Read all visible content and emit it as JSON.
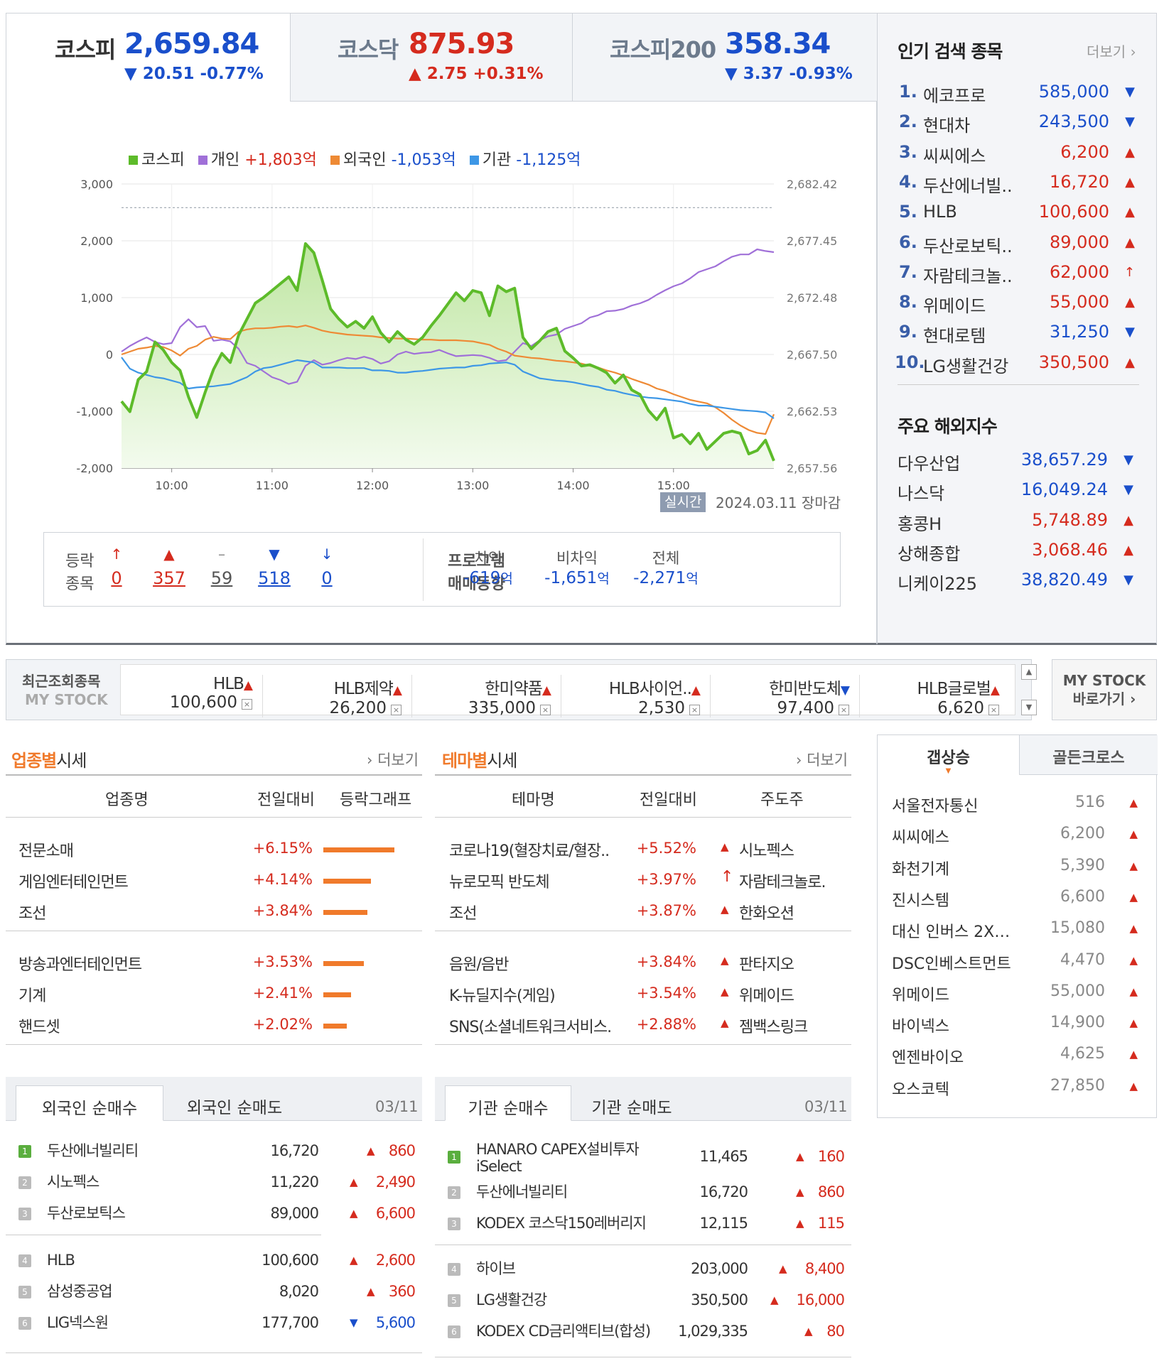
{
  "indices": [
    {
      "name": "코스피",
      "value": "2,659.84",
      "change": "▼ 20.51 -0.77%",
      "dir": "down"
    },
    {
      "name": "코스닥",
      "value": "875.93",
      "change": "▲ 2.75 +0.31%",
      "dir": "up"
    },
    {
      "name": "코스피200",
      "value": "358.34",
      "change": "▼ 3.37 -0.93%",
      "dir": "down"
    }
  ],
  "legend": [
    {
      "label": "코스피",
      "value": "",
      "color": "#5dbb2a"
    },
    {
      "label": "개인",
      "value": "+1,803억",
      "color": "#a070d8"
    },
    {
      "label": "외국인",
      "value": "-1,053억",
      "color": "#ee8a35"
    },
    {
      "label": "기관",
      "value": "-1,125억",
      "color": "#3d97e6"
    }
  ],
  "chart_data": {
    "type": "line",
    "x_ticks": [
      "10:00",
      "11:00",
      "12:00",
      "13:00",
      "14:00",
      "15:00"
    ],
    "y_left_ticks": [
      "3,000",
      "2,000",
      "1,000",
      "0",
      "-1,000",
      "-2,000"
    ],
    "y_right_ticks": [
      "2,682.42",
      "2,677.45",
      "2,672.48",
      "2,667.50",
      "2,662.53",
      "2,657.56"
    ],
    "ylim_left": [
      -2000,
      3000
    ],
    "ylim_right": [
      2657.56,
      2682.42
    ],
    "prev_close": 2680.35,
    "x_minutes": [
      0,
      5,
      10,
      15,
      20,
      25,
      30,
      35,
      40,
      45,
      50,
      55,
      60,
      65,
      70,
      75,
      80,
      85,
      90,
      95,
      100,
      105,
      110,
      115,
      120,
      125,
      130,
      135,
      140,
      145,
      150,
      155,
      160,
      165,
      170,
      175,
      180,
      185,
      190,
      195,
      200,
      205,
      210,
      215,
      220,
      225,
      230,
      235,
      240,
      245,
      250,
      255,
      260,
      265,
      270,
      275,
      280,
      285,
      290,
      295,
      300,
      305,
      310,
      315,
      320,
      325,
      330,
      335,
      340,
      345,
      350,
      355,
      360,
      365,
      370,
      375,
      380,
      385,
      390
    ],
    "series": [
      {
        "name": "코스피",
        "axis": "right",
        "values": [
          2663.4,
          2662.5,
          2665.3,
          2666.0,
          2668.6,
          2667.9,
          2666.8,
          2666.1,
          2663.8,
          2662.0,
          2664.2,
          2666.2,
          2667.6,
          2666.8,
          2669.2,
          2670.6,
          2672.0,
          2672.5,
          2673.1,
          2673.7,
          2674.3,
          2673.1,
          2677.2,
          2676.4,
          2674.0,
          2671.5,
          2670.6,
          2669.9,
          2670.4,
          2669.8,
          2670.8,
          2669.4,
          2668.6,
          2669.5,
          2668.8,
          2668.4,
          2669.0,
          2670.0,
          2670.9,
          2671.9,
          2672.9,
          2672.2,
          2673.1,
          2672.9,
          2670.9,
          2673.5,
          2673.0,
          2673.3,
          2669.0,
          2668.0,
          2668.7,
          2669.5,
          2669.8,
          2667.8,
          2667.2,
          2666.5,
          2666.6,
          2666.3,
          2665.9,
          2665.0,
          2665.7,
          2664.4,
          2664.0,
          2662.6,
          2661.8,
          2662.8,
          2660.2,
          2660.5,
          2659.7,
          2660.6,
          2659.2,
          2659.9,
          2660.6,
          2660.8,
          2660.6,
          2658.8,
          2659.1,
          2660.0,
          2658.2
        ]
      },
      {
        "name": "개인",
        "axis": "left",
        "values": [
          50,
          150,
          230,
          300,
          220,
          180,
          200,
          480,
          620,
          480,
          500,
          240,
          260,
          230,
          100,
          -150,
          -200,
          -300,
          -400,
          -450,
          -520,
          -480,
          -200,
          -100,
          -180,
          -150,
          -100,
          -60,
          -80,
          -40,
          -80,
          -160,
          -120,
          0,
          50,
          10,
          30,
          40,
          80,
          20,
          -30,
          -20,
          -10,
          -20,
          -60,
          -120,
          -100,
          50,
          200,
          150,
          250,
          320,
          350,
          450,
          500,
          550,
          650,
          690,
          760,
          770,
          800,
          860,
          900,
          960,
          1050,
          1130,
          1200,
          1250,
          1340,
          1450,
          1500,
          1550,
          1640,
          1720,
          1760,
          1760,
          1850,
          1820,
          1800
        ]
      },
      {
        "name": "외국인",
        "axis": "left",
        "values": [
          0,
          50,
          100,
          120,
          150,
          130,
          70,
          -20,
          100,
          150,
          260,
          310,
          280,
          270,
          400,
          440,
          460,
          460,
          470,
          490,
          500,
          480,
          510,
          470,
          420,
          390,
          370,
          350,
          340,
          330,
          320,
          300,
          290,
          280,
          280,
          270,
          260,
          260,
          250,
          250,
          250,
          240,
          230,
          200,
          170,
          100,
          50,
          -20,
          -40,
          -60,
          -70,
          -90,
          -110,
          -120,
          -140,
          -160,
          -200,
          -230,
          -280,
          -320,
          -370,
          -430,
          -480,
          -530,
          -600,
          -640,
          -700,
          -750,
          -800,
          -830,
          -860,
          -930,
          -1030,
          -1150,
          -1250,
          -1330,
          -1380,
          -1400,
          -1053
        ]
      },
      {
        "name": "기관",
        "axis": "left",
        "values": [
          -50,
          -250,
          -320,
          -360,
          -400,
          -420,
          -460,
          -500,
          -600,
          -580,
          -570,
          -560,
          -540,
          -520,
          -460,
          -400,
          -300,
          -240,
          -220,
          -180,
          -140,
          -100,
          -120,
          -140,
          -230,
          -230,
          -230,
          -240,
          -240,
          -240,
          -280,
          -280,
          -290,
          -320,
          -320,
          -300,
          -290,
          -270,
          -250,
          -240,
          -230,
          -230,
          -200,
          -190,
          -160,
          -150,
          -140,
          -180,
          -300,
          -360,
          -420,
          -440,
          -460,
          -470,
          -490,
          -520,
          -550,
          -570,
          -620,
          -640,
          -680,
          -710,
          -740,
          -760,
          -770,
          -790,
          -810,
          -830,
          -870,
          -900,
          -900,
          -920,
          -940,
          -960,
          -980,
          -990,
          -1000,
          -1020,
          -1125
        ]
      }
    ]
  },
  "status": {
    "realtime": "실시간",
    "date": "2024.03.11 장마감"
  },
  "breadth": {
    "label1": "등락",
    "label2": "종목",
    "counts": [
      {
        "v": "0",
        "icon": "↑",
        "cls": "up"
      },
      {
        "v": "357",
        "icon": "▲",
        "cls": "up"
      },
      {
        "v": "59",
        "icon": "–",
        "cls": ""
      },
      {
        "v": "518",
        "icon": "▼",
        "cls": "dn"
      },
      {
        "v": "0",
        "icon": "↓",
        "cls": "dn"
      }
    ],
    "prog1": "프로그램",
    "prog2": "매매동향",
    "program": [
      {
        "h": "차익",
        "v": "-619",
        "u": "억"
      },
      {
        "h": "비차익",
        "v": "-1,651",
        "u": "억"
      },
      {
        "h": "전체",
        "v": "-2,271",
        "u": "억"
      }
    ]
  },
  "popular": {
    "title": "인기 검색 종목",
    "more": "더보기",
    "items": [
      {
        "rank": "1.",
        "name": "에코프로",
        "price": "585,000",
        "dir": "dn",
        "icon": "▼"
      },
      {
        "rank": "2.",
        "name": "현대차",
        "price": "243,500",
        "dir": "dn",
        "icon": "▼"
      },
      {
        "rank": "3.",
        "name": "씨씨에스",
        "price": "6,200",
        "dir": "up",
        "icon": "▲"
      },
      {
        "rank": "4.",
        "name": "두산에너빌..",
        "price": "16,720",
        "dir": "up",
        "icon": "▲"
      },
      {
        "rank": "5.",
        "name": "HLB",
        "price": "100,600",
        "dir": "up",
        "icon": "▲"
      },
      {
        "rank": "6.",
        "name": "두산로보틱..",
        "price": "89,000",
        "dir": "up",
        "icon": "▲"
      },
      {
        "rank": "7.",
        "name": "자람테크놀..",
        "price": "62,000",
        "dir": "up",
        "icon": "↑"
      },
      {
        "rank": "8.",
        "name": "위메이드",
        "price": "55,000",
        "dir": "up",
        "icon": "▲"
      },
      {
        "rank": "9.",
        "name": "현대로템",
        "price": "31,250",
        "dir": "dn",
        "icon": "▼"
      },
      {
        "rank": "10.",
        "name": "LG생활건강",
        "price": "350,500",
        "dir": "up",
        "icon": "▲"
      }
    ]
  },
  "overseas": {
    "title": "주요 해외지수",
    "items": [
      {
        "name": "다우산업",
        "price": "38,657.29",
        "dir": "dn",
        "icon": "▼"
      },
      {
        "name": "나스닥",
        "price": "16,049.24",
        "dir": "dn",
        "icon": "▼"
      },
      {
        "name": "홍콩H",
        "price": "5,748.89",
        "dir": "up",
        "icon": "▲"
      },
      {
        "name": "상해종합",
        "price": "3,068.46",
        "dir": "up",
        "icon": "▲"
      },
      {
        "name": "니케이225",
        "price": "38,820.49",
        "dir": "dn",
        "icon": "▼"
      }
    ]
  },
  "recent": {
    "label1": "최근조회종목",
    "label2": "MY STOCK",
    "items": [
      {
        "name": "HLB",
        "icon": "▲",
        "dir": "up",
        "price": "100,600"
      },
      {
        "name": "HLB제약",
        "icon": "▲",
        "dir": "up",
        "price": "26,200"
      },
      {
        "name": "한미약품",
        "icon": "▲",
        "dir": "up",
        "price": "335,000"
      },
      {
        "name": "HLB사이언..",
        "icon": "▲",
        "dir": "up",
        "price": "2,530"
      },
      {
        "name": "한미반도체",
        "icon": "▼",
        "dir": "dn",
        "price": "97,400"
      },
      {
        "name": "HLB글로벌",
        "icon": "▲",
        "dir": "up",
        "price": "6,620"
      }
    ],
    "mystock1": "MY STOCK",
    "mystock2": "바로가기 ›"
  },
  "sector": {
    "title_a": "업종별",
    "title_b": "시세",
    "more": "더보기",
    "h1": "업종명",
    "h2": "전일대비",
    "h3": "등락그래프",
    "rows": [
      {
        "name": "전문소매",
        "chg": "+6.15%",
        "pct": 6.15
      },
      {
        "name": "게임엔터테인먼트",
        "chg": "+4.14%",
        "pct": 4.14
      },
      {
        "name": "조선",
        "chg": "+3.84%",
        "pct": 3.84
      },
      {
        "name": "방송과엔터테인먼트",
        "chg": "+3.53%",
        "pct": 3.53
      },
      {
        "name": "기계",
        "chg": "+2.41%",
        "pct": 2.41
      },
      {
        "name": "핸드셋",
        "chg": "+2.02%",
        "pct": 2.02
      }
    ]
  },
  "theme": {
    "title_a": "테마별",
    "title_b": "시세",
    "more": "더보기",
    "h1": "테마명",
    "h2": "전일대비",
    "h3": "주도주",
    "rows": [
      {
        "name": "코로나19(혈장치료/혈장..",
        "chg": "+5.52%",
        "icon": "▲",
        "lead": "시노펙스"
      },
      {
        "name": "뉴로모픽 반도체",
        "chg": "+3.97%",
        "icon": "↑",
        "lead": "자람테크놀로."
      },
      {
        "name": "조선",
        "chg": "+3.87%",
        "icon": "▲",
        "lead": "한화오션"
      },
      {
        "name": "음원/음반",
        "chg": "+3.84%",
        "icon": "▲",
        "lead": "판타지오"
      },
      {
        "name": "K-뉴딜지수(게임)",
        "chg": "+3.54%",
        "icon": "▲",
        "lead": "위메이드"
      },
      {
        "name": "SNS(소셜네트워크서비스..",
        "chg": "+2.88%",
        "icon": "▲",
        "lead": "젬백스링크"
      }
    ]
  },
  "gap": {
    "tab1": "갭상승",
    "tab2": "골든크로스",
    "items": [
      {
        "name": "서울전자통신",
        "price": "516"
      },
      {
        "name": "씨씨에스",
        "price": "6,200"
      },
      {
        "name": "화천기계",
        "price": "5,390"
      },
      {
        "name": "진시스템",
        "price": "6,600"
      },
      {
        "name": "대신 인버스 2X…",
        "price": "15,080"
      },
      {
        "name": "DSC인베스트먼트",
        "price": "4,470"
      },
      {
        "name": "위메이드",
        "price": "55,000"
      },
      {
        "name": "바이넥스",
        "price": "14,900"
      },
      {
        "name": "엔젠바이오",
        "price": "4,625"
      },
      {
        "name": "오스코텍",
        "price": "27,850"
      }
    ]
  },
  "foreign": {
    "tab1": "외국인 순매수",
    "tab2": "외국인 순매도",
    "date": "03/11",
    "rows": [
      {
        "rank": "1",
        "name": "두산에너빌리티",
        "price": "16,720",
        "icon": "▲",
        "chg": "860",
        "dir": "up"
      },
      {
        "rank": "2",
        "name": "시노펙스",
        "price": "11,220",
        "icon": "▲",
        "chg": "2,490",
        "dir": "up"
      },
      {
        "rank": "3",
        "name": "두산로보틱스",
        "price": "89,000",
        "icon": "▲",
        "chg": "6,600",
        "dir": "up"
      },
      {
        "rank": "4",
        "name": "HLB",
        "price": "100,600",
        "icon": "▲",
        "chg": "2,600",
        "dir": "up"
      },
      {
        "rank": "5",
        "name": "삼성중공업",
        "price": "8,020",
        "icon": "▲",
        "chg": "360",
        "dir": "up"
      },
      {
        "rank": "6",
        "name": "LIG넥스원",
        "price": "177,700",
        "icon": "▼",
        "chg": "5,600",
        "dir": "dn"
      }
    ]
  },
  "inst": {
    "tab1": "기관 순매수",
    "tab2": "기관 순매도",
    "date": "03/11",
    "rows": [
      {
        "rank": "1",
        "name": "HANARO CAPEX설비투자",
        "name2": "iSelect",
        "price": "11,465",
        "icon": "▲",
        "chg": "160",
        "dir": "up"
      },
      {
        "rank": "2",
        "name": "두산에너빌리티",
        "name2": "",
        "price": "16,720",
        "icon": "▲",
        "chg": "860",
        "dir": "up"
      },
      {
        "rank": "3",
        "name": "KODEX 코스닥150레버리지",
        "name2": "",
        "price": "12,115",
        "icon": "▲",
        "chg": "115",
        "dir": "up"
      },
      {
        "rank": "4",
        "name": "하이브",
        "name2": "",
        "price": "203,000",
        "icon": "▲",
        "chg": "8,400",
        "dir": "up"
      },
      {
        "rank": "5",
        "name": "LG생활건강",
        "name2": "",
        "price": "350,500",
        "icon": "▲",
        "chg": "16,000",
        "dir": "up"
      },
      {
        "rank": "6",
        "name": "KODEX CD금리액티브(합성)",
        "name2": "",
        "price": "1,029,335",
        "icon": "▲",
        "chg": "80",
        "dir": "up"
      }
    ]
  }
}
